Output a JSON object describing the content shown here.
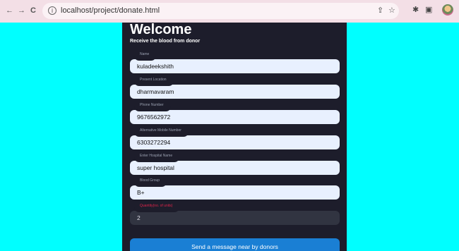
{
  "browser": {
    "url": "localhost/project/donate.html",
    "back_glyph": "←",
    "forward_glyph": "→",
    "reload_glyph": "C",
    "info_glyph": "i",
    "share_glyph": "⇪",
    "star_glyph": "☆",
    "extension_glyph": "✱",
    "sidepanel_glyph": "▣"
  },
  "page": {
    "title": "Welcome",
    "subtitle": "Receive the blood from donor"
  },
  "form": {
    "fields": [
      {
        "label": "Name",
        "value": "kuladeekshith"
      },
      {
        "label": "Present Location",
        "value": "dharmavaram"
      },
      {
        "label": "Phone Number",
        "value": "9676562972"
      },
      {
        "label": "Alternative Mobile Number",
        "value": "6303272294"
      },
      {
        "label": "Enter Hospital Name",
        "value": "super hospital"
      },
      {
        "label": "Blood Group",
        "value": "B+"
      },
      {
        "label": "Quantity(no. of units)",
        "value": "2"
      }
    ],
    "submit_label": "Send a message near by donors"
  },
  "colors": {
    "page_background": "#00ffff",
    "panel_background": "#1d1d2b",
    "autofill_input": "#e8f0fe",
    "plain_input": "#313441",
    "quantity_label": "#e0244a",
    "button": "#1a7fd4"
  }
}
